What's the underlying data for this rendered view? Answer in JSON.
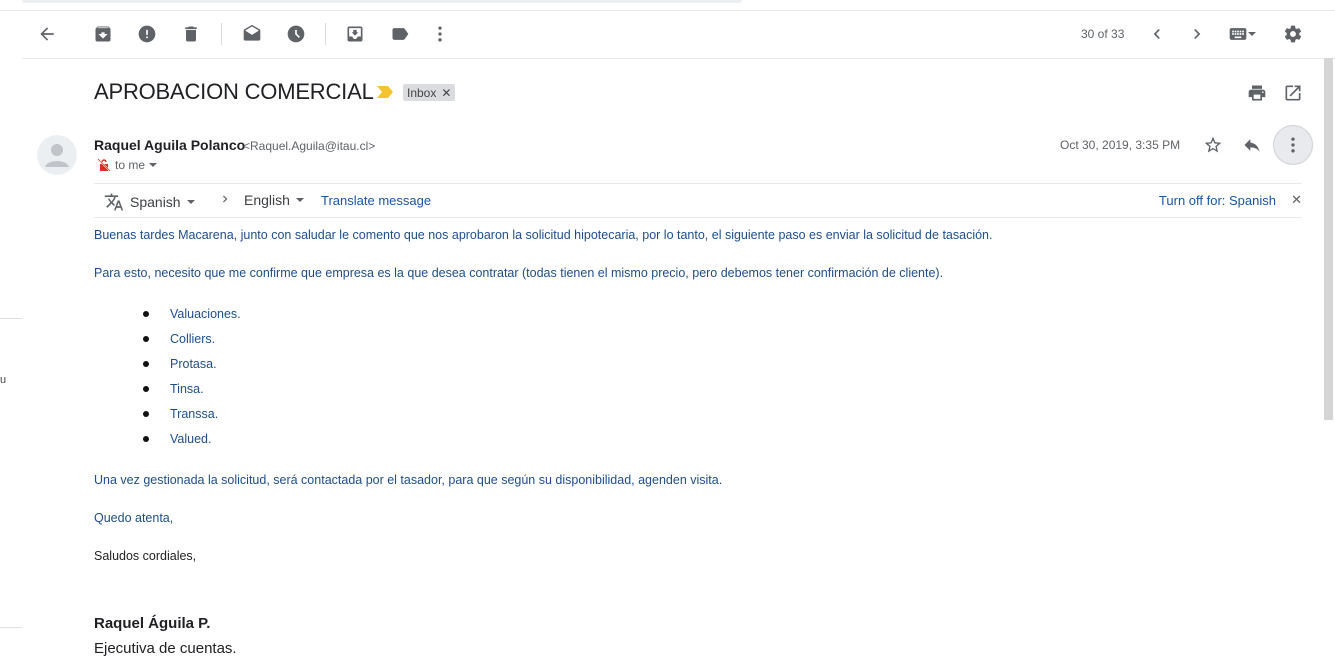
{
  "toolbar": {
    "back": "arrow-left-icon",
    "archive": "archive-icon",
    "spam": "report-spam-icon",
    "delete": "trash-icon",
    "mark_unread": "mark-unread-icon",
    "snooze": "clock-icon",
    "move_to": "move-to-inbox-icon",
    "labels": "label-icon",
    "more": "more-vert-icon",
    "count": "30 of 33",
    "older": "chevron-left-icon",
    "newer": "chevron-right-icon",
    "input_tools": "keyboard-icon",
    "settings": "gear-icon"
  },
  "email": {
    "subject": "APROBACION COMERCIAL",
    "label": "Inbox",
    "sender_name": "Raquel Aguila Polanco",
    "sender_email": "<Raquel.Aguila@itau.cl>",
    "to": "to me",
    "date": "Oct 30, 2019, 3:35 PM"
  },
  "translate": {
    "from_lang": "Spanish",
    "to_lang": "English",
    "action": "Translate message",
    "turn_off": "Turn off for: Spanish"
  },
  "body": {
    "p1": "Buenas tardes  Macarena, junto con saludar le comento que nos aprobaron la solicitud hipotecaria, por lo tanto, el siguiente paso es enviar la solicitud de tasación.",
    "p2": "Para esto, necesito que me confirme que empresa es la que desea contratar (todas tienen el mismo precio, pero debemos tener confirmación de cliente).",
    "list": [
      "Valuaciones.",
      "Colliers.",
      "Protasa.",
      "Tinsa.",
      "Transsa.",
      "Valued."
    ],
    "p3": "Una vez gestionada la solicitud, será contactada por el tasador, para que según su disponibilidad, agenden visita.",
    "p4": "Quedo atenta,",
    "p5": "Saludos cordiales,",
    "sig_name": "Raquel Águila P.",
    "sig_role": "Ejecutiva de cuentas."
  },
  "side": {
    "glyph": "u"
  },
  "colors": {
    "link": "#1a57a6",
    "body_blue": "#1f4e8c",
    "important": "#f4c430"
  }
}
